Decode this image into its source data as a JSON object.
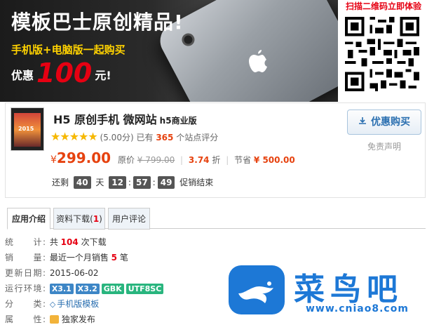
{
  "banner": {
    "title": "模板巴士原创精品!",
    "subtitle": "手机版+电脑版一起购买",
    "promo_prefix": "优惠",
    "promo_amount": "100",
    "promo_suffix": "元!",
    "apple_icon": "apple-logo-icon"
  },
  "qr": {
    "title": "扫描二维码立即体验",
    "icon": "qr-code"
  },
  "product": {
    "title": "H5 原创手机 微网站",
    "title_tag": "h5商业版",
    "thumb_text": "2015",
    "rating_stars": 5,
    "rating_score": "(5.00分)",
    "rating_prefix": "已有",
    "rating_count": "365",
    "rating_suffix": "个站点评分",
    "currency": "¥",
    "price": "299.00",
    "orig_label": "原价",
    "orig_price": "¥ 799.00",
    "discount": "3.74",
    "discount_unit": "折",
    "save_label": "节省",
    "save_amount": "¥ 500.00",
    "countdown_prefix": "还剩",
    "days": "40",
    "days_label": "天",
    "hours": "12",
    "minutes": "57",
    "seconds": "49",
    "countdown_suffix": "促销结束",
    "buy_label": "优惠购买",
    "disclaimer": "免责声明"
  },
  "tabs": [
    {
      "label": "应用介绍"
    },
    {
      "label": "资料下载(",
      "count": "1",
      "close": ")"
    },
    {
      "label": "用户评论"
    }
  ],
  "info": {
    "stats_label": "统　　计:",
    "stats_prefix": "共",
    "stats_count": "104",
    "stats_suffix": "次下载",
    "sales_label": "销　　量:",
    "sales_prefix": "最近一个月销售",
    "sales_count": "5",
    "sales_suffix": "笔",
    "date_label": "更新日期:",
    "date": "2015-06-02",
    "env_label": "运行环境:",
    "env": [
      "X3.1",
      "X3.2",
      "GBK",
      "UTF8SC"
    ],
    "cat_label": "分　　类:",
    "cat": "手机版模板",
    "attr_label": "属　　性:",
    "attr": "独家发布"
  },
  "watermark": {
    "name": "菜鸟吧",
    "url": "www.cniao8.com"
  },
  "colors": {
    "accent_red": "#e60012",
    "price_orange": "#e6420f",
    "link_blue": "#2a6fb0",
    "env_blue": "#3d86c6",
    "env_green": "#29b57e",
    "watermark_blue": "#1d78d6"
  }
}
